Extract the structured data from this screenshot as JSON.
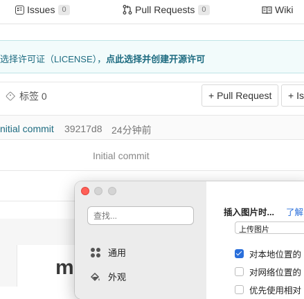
{
  "topnav": {
    "tabs": [
      {
        "label": "Issues",
        "count": "0",
        "icon": "issues-icon"
      },
      {
        "label": "Pull Requests",
        "count": "0",
        "icon": "pull-request-icon"
      },
      {
        "label": "Wiki",
        "icon": "wiki-book-icon"
      }
    ]
  },
  "banner": {
    "text": "选择许可证（LICENSE），",
    "link": "点此选择并创建开源许可"
  },
  "tags": {
    "label": "标签 0",
    "pull_request_button": "+ Pull Request",
    "issue_button": "+ Is"
  },
  "commit": {
    "message": "nitial commit",
    "hash": "39217d8",
    "time": "24分钟前"
  },
  "file_row": {
    "commit_message": "Initial commit"
  },
  "readme": {
    "heading_fragment": "m"
  },
  "preferences": {
    "search_placeholder": "查找...",
    "sidebar_items": [
      {
        "label": "通用",
        "icon": "general-grid-icon"
      },
      {
        "label": "外观",
        "icon": "appearance-paint-icon"
      }
    ],
    "image_section_title": "插入图片时...",
    "learn_more_link": "了解",
    "upload_select_value": "上传图片",
    "options": [
      {
        "label": "对本地位置的",
        "checked": true
      },
      {
        "label": "对网络位置的",
        "checked": false
      },
      {
        "label": "优先使用相对",
        "checked": false
      }
    ]
  },
  "colors": {
    "link_teal": "#1d6b80",
    "banner_bg": "#f2fbfb",
    "checkbox_blue": "#2a6fdb",
    "close_red": "#ff5f57"
  }
}
